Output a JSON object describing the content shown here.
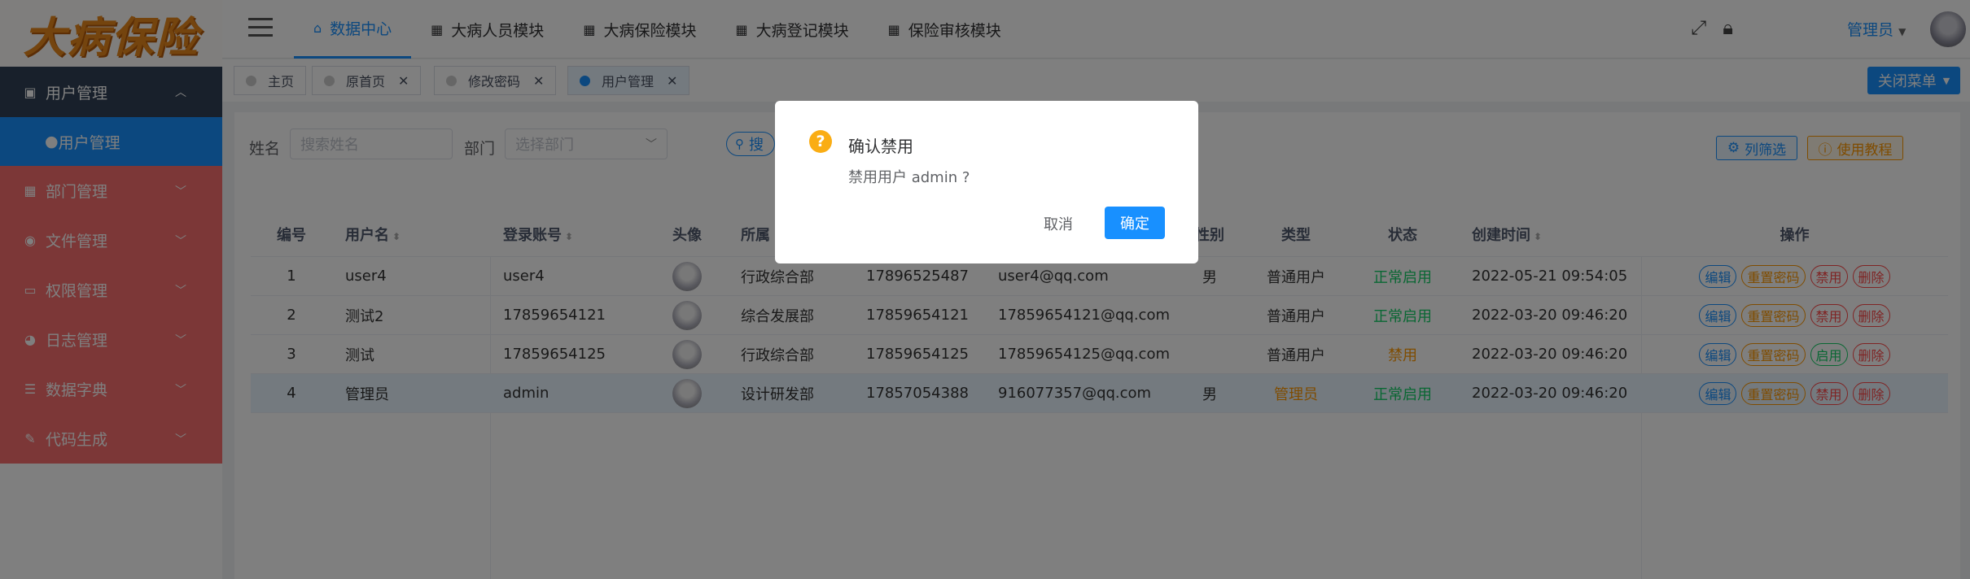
{
  "logo": "大病保险",
  "sidebar": {
    "group": "用户管理",
    "sub": "用户管理",
    "items": [
      {
        "label": "部门管理"
      },
      {
        "label": "文件管理"
      },
      {
        "label": "权限管理"
      },
      {
        "label": "日志管理"
      },
      {
        "label": "数据字典"
      },
      {
        "label": "代码生成"
      }
    ]
  },
  "header": {
    "nav": [
      "数据中心",
      "大病人员模块",
      "大病保险模块",
      "大病登记模块",
      "保险审核模块"
    ],
    "user": "管理员"
  },
  "tags": [
    {
      "label": "主页"
    },
    {
      "label": "原首页"
    },
    {
      "label": "修改密码"
    },
    {
      "label": "用户管理"
    }
  ],
  "close_menu": "关闭菜单",
  "filters": {
    "name_label": "姓名",
    "name_placeholder": "搜索姓名",
    "dept_label": "部门",
    "dept_placeholder": "选择部门",
    "search": "搜",
    "column_filter": "列筛选",
    "tutorial": "使用教程"
  },
  "table": {
    "headers": [
      "编号",
      "用户名",
      "登录账号",
      "头像",
      "所属",
      "",
      "",
      "性别",
      "类型",
      "状态",
      "创建时间",
      "操作"
    ],
    "rows": [
      {
        "id": "1",
        "username": "user4",
        "account": "user4",
        "dept": "行政综合部",
        "phone": "17896525487",
        "email": "user4@qq.com",
        "gender": "男",
        "type": "普通用户",
        "status": "正常启用",
        "created": "2022-05-21 09:54:05",
        "toggle": "禁用"
      },
      {
        "id": "2",
        "username": "测试2",
        "account": "17859654121",
        "dept": "综合发展部",
        "phone": "17859654121",
        "email": "17859654121@qq.com",
        "gender": "",
        "type": "普通用户",
        "status": "正常启用",
        "created": "2022-03-20 09:46:20",
        "toggle": "禁用"
      },
      {
        "id": "3",
        "username": "测试",
        "account": "17859654125",
        "dept": "行政综合部",
        "phone": "17859654125",
        "email": "17859654125@qq.com",
        "gender": "",
        "type": "普通用户",
        "status": "禁用",
        "created": "2022-03-20 09:46:20",
        "toggle": "启用"
      },
      {
        "id": "4",
        "username": "管理员",
        "account": "admin",
        "dept": "设计研发部",
        "phone": "17857054388",
        "email": "916077357@qq.com",
        "gender": "男",
        "type": "管理员",
        "status": "正常启用",
        "created": "2022-03-20 09:46:20",
        "toggle": "禁用"
      }
    ],
    "ops": {
      "edit": "编辑",
      "reset": "重置密码",
      "delete": "删除"
    }
  },
  "modal": {
    "icon": "?",
    "title": "确认禁用",
    "message": "禁用用户 admin ?",
    "cancel": "取消",
    "ok": "确定"
  }
}
